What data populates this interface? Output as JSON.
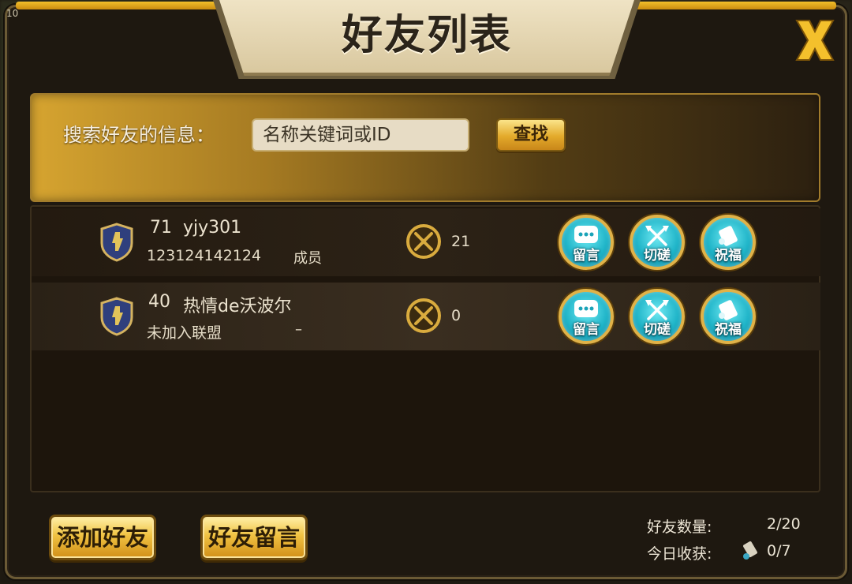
{
  "window": {
    "title": "好友列表",
    "corner_level": "10"
  },
  "search": {
    "label": "搜索好友的信息：",
    "placeholder": "名称关键词或ID",
    "button_label": "查找"
  },
  "friends": [
    {
      "level": "71",
      "name": "yjy301",
      "guild": "123124142124",
      "role": "成员",
      "power": "21",
      "actions": [
        "留言",
        "切磋",
        "祝福"
      ]
    },
    {
      "level": "40",
      "name": "热情de沃波尔",
      "guild": "未加入联盟",
      "role": "–",
      "power": "0",
      "actions": [
        "留言",
        "切磋",
        "祝福"
      ]
    }
  ],
  "footer": {
    "add_friend_label": "添加好友",
    "friend_message_label": "好友留言",
    "friend_count_label": "好友数量:",
    "friend_count_value": "2/20",
    "today_harvest_label": "今日收获:",
    "today_harvest_value": "0/7"
  },
  "colors": {
    "accent_gold": "#e3aa2b",
    "action_cyan": "#1fb4c8",
    "title_text": "#2b241a"
  },
  "icons": {
    "close": "close-x-icon",
    "shield": "shield-badge-icon",
    "power": "crossed-swords-icon",
    "message": "chat-bubble-icon",
    "duel": "crossed-axes-icon",
    "bless": "scroll-icon",
    "harvest": "scroll-icon"
  }
}
